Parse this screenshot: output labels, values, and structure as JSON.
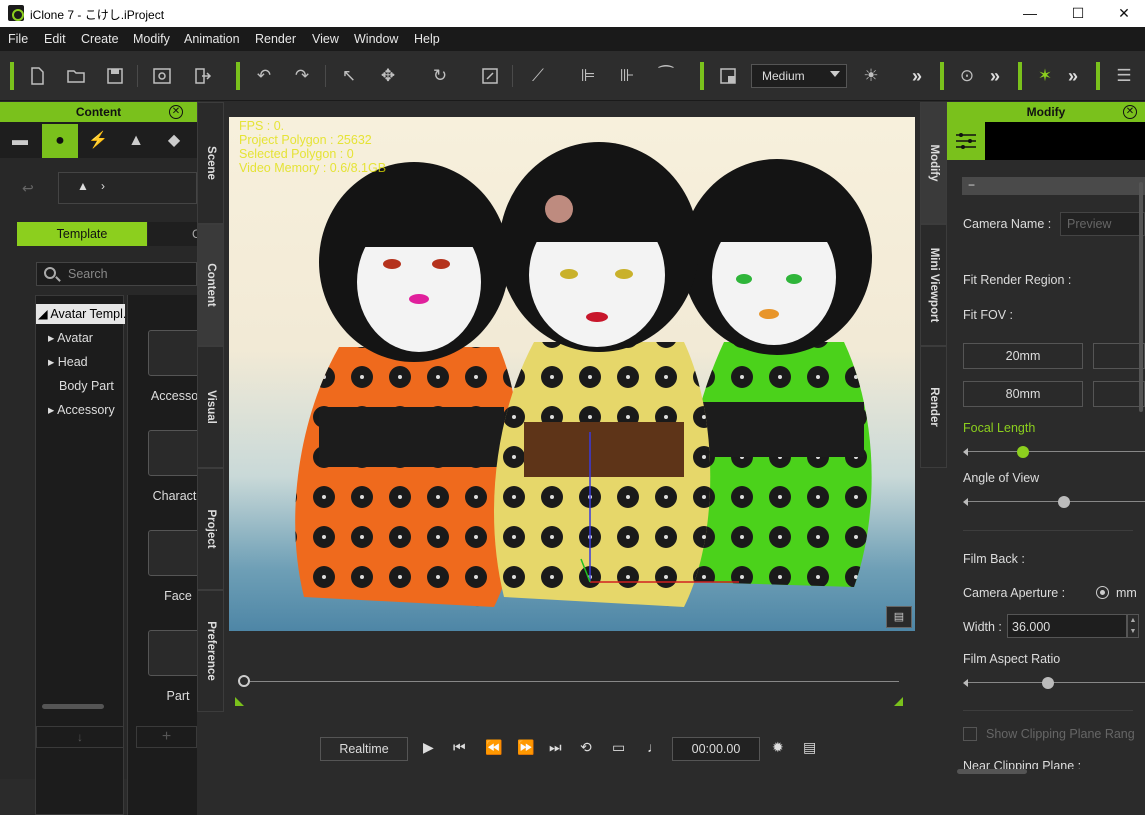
{
  "window": {
    "title": "iClone 7 - こけし.iProject",
    "minimize": "—",
    "maximize": "☐",
    "close": "✕"
  },
  "menu": [
    "File",
    "Edit",
    "Create",
    "Modify",
    "Animation",
    "Render",
    "View",
    "Window",
    "Help"
  ],
  "toolbar": {
    "quality": "Medium"
  },
  "content_panel": {
    "title": "Content",
    "template_tab": "Template",
    "second_tab": "C",
    "search_placeholder": "Search",
    "tree": [
      "Avatar Templ.",
      "Avatar",
      "Head",
      "Body Part",
      "Accessory"
    ],
    "thumbs": [
      "Accessori",
      "Characte",
      "Face",
      "Part"
    ]
  },
  "side_tabs_left": [
    "Scene",
    "Content",
    "Visual",
    "Project",
    "Preference"
  ],
  "side_tabs_right": [
    "Modify",
    "Mini Viewport",
    "Render"
  ],
  "viewport": {
    "hud": [
      "FPS : 0.",
      "Project Polygon : 25632",
      "Selected Polygon : 0",
      "Video Memory : 0.6/8.1GB"
    ]
  },
  "playback": {
    "mode": "Realtime",
    "time": "00:00.00"
  },
  "modify_panel": {
    "title": "Modify",
    "collapse": "−",
    "camera_name_label": "Camera Name :",
    "camera_name_value": "Preview",
    "fit_render_region": "Fit Render Region :",
    "fit_fov": "Fit FOV :",
    "fov_buttons": [
      "20mm",
      "80mm"
    ],
    "focal_length": "Focal Length",
    "focal_length_value": 0.3,
    "angle_of_view": "Angle of View",
    "angle_of_view_value": 0.55,
    "film_back": "Film Back :",
    "camera_aperture": "Camera Aperture :",
    "aperture_unit": "mm",
    "width_label": "Width :",
    "width_value": "36.000",
    "film_aspect_ratio": "Film Aspect Ratio",
    "film_aspect_value": 0.45,
    "show_clipping": "Show Clipping Plane Rang",
    "near_clipping": "Near Clipping Plane :"
  },
  "colors": {
    "accent": "#7ac11c",
    "hud": "#e0e000"
  }
}
